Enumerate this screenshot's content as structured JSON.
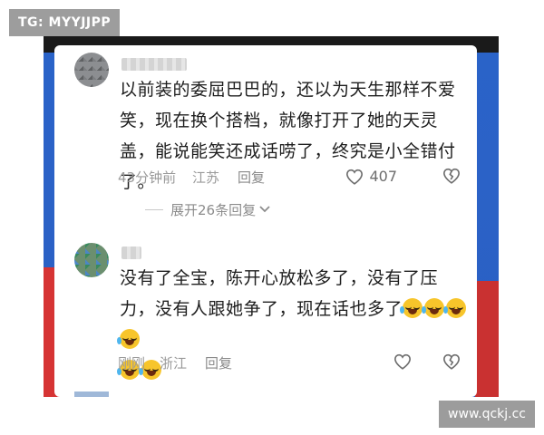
{
  "watermarks": {
    "top_left": "TG: MYYJJPP",
    "bottom_right": "www.qckj.cc"
  },
  "colors": {
    "background_blue": "#2a63c8",
    "card": "#ffffff",
    "text_primary": "#1d1d1d",
    "text_secondary": "#9a9a9a",
    "emoji_yellow": "#f7c52b"
  },
  "comments": [
    {
      "username": "",
      "text": "以前装的委屈巴巴的，还以为天生那样不爱笑，现在换个搭档，就像打开了她的天灵盖，能说能笑还成话唠了，终究是小全错付了。",
      "emoji_count": 0,
      "time": "43分钟前",
      "location": "江苏",
      "reply_label": "回复",
      "likes": "407",
      "like_icon": "heart-outline-icon",
      "dislike_icon": "broken-heart-icon"
    },
    {
      "username": "",
      "text": "没有了全宝，陈开心放松多了，没有了压力，没有人跟她争了，现在话也多了",
      "emoji_count": 6,
      "emoji_icon": "laughing-crying-emoji-icon",
      "time": "刚刚",
      "location": "浙江",
      "reply_label": "回复",
      "likes": "",
      "like_icon": "heart-outline-icon",
      "dislike_icon": "broken-heart-icon"
    }
  ],
  "replies_toggle": {
    "label": "展开26条回复",
    "icon": "chevron-down-icon"
  }
}
